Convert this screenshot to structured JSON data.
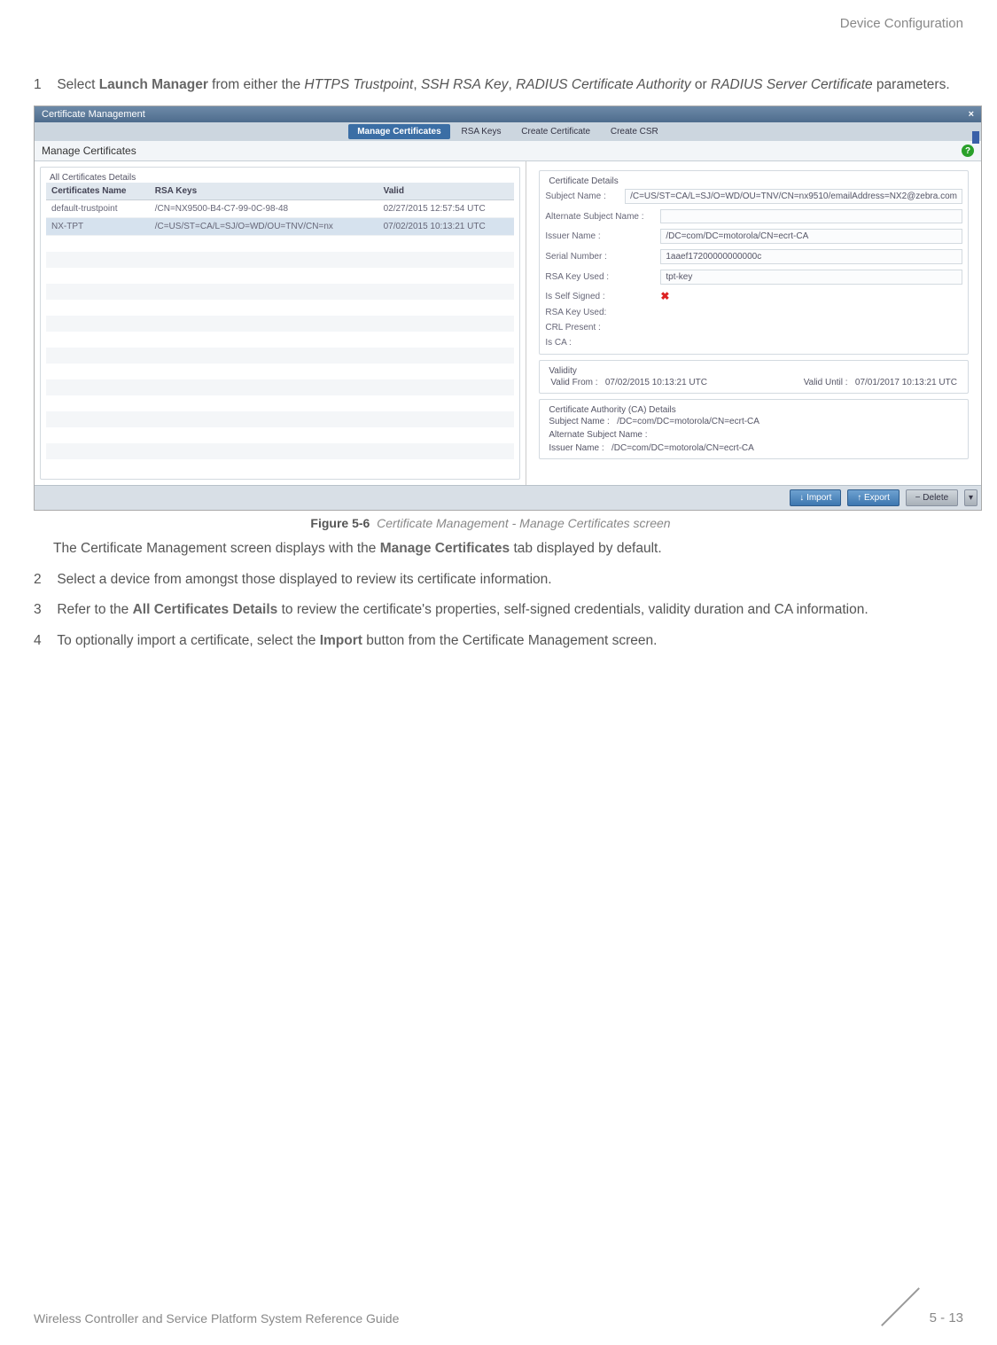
{
  "header": {
    "section_title": "Device Configuration"
  },
  "steps": {
    "s1": {
      "num": "1",
      "pre": "Select ",
      "launch": "Launch Manager",
      "mid1": " from either the ",
      "p1": "HTTPS Trustpoint",
      "c1": ", ",
      "p2": "SSH RSA Key",
      "c2": ", ",
      "p3": "RADIUS Certificate Authority",
      "or": " or ",
      "p4": "RADIUS Server Certificate",
      "end": " parameters."
    },
    "post1": {
      "pre": "The Certificate Management screen displays with the ",
      "tab": "Manage Certificates",
      "end": " tab displayed by default."
    },
    "s2": {
      "num": "2",
      "txt": "Select a device from amongst those displayed to review its certificate information."
    },
    "s3": {
      "num": "3",
      "pre": "Refer to the ",
      "bold": "All Certificates Details",
      "end": " to review the certificate's properties, self-signed credentials, validity duration and CA information."
    },
    "s4": {
      "num": "4",
      "pre": "To optionally import a certificate, select the ",
      "bold": "Import",
      "end": " button from the Certificate Management screen."
    }
  },
  "fig": {
    "label": "Figure 5-6",
    "caption": "Certificate Management - Manage Certificates screen"
  },
  "ss": {
    "title": "Certificate Management",
    "tabs": [
      "Manage Certificates",
      "RSA Keys",
      "Create Certificate",
      "Create CSR"
    ],
    "subtitle": "Manage Certificates",
    "left_fs": "All Certificates Details",
    "table_headers": [
      "Certificates Name",
      "RSA Keys",
      "Valid"
    ],
    "rows": [
      {
        "name": "default-trustpoint",
        "rsa": "/CN=NX9500-B4-C7-99-0C-98-48",
        "valid": "02/27/2015 12:57:54 UTC"
      },
      {
        "name": "NX-TPT",
        "rsa": "/C=US/ST=CA/L=SJ/O=WD/OU=TNV/CN=nx",
        "valid": "07/02/2015 10:13:21 UTC"
      }
    ],
    "right_fs": "Certificate Details",
    "details": {
      "subject_lbl": "Subject Name :",
      "subject_val": "/C=US/ST=CA/L=SJ/O=WD/OU=TNV/CN=nx9510/emailAddress=NX2@zebra.com",
      "alt_lbl": "Alternate Subject Name :",
      "alt_val": "",
      "issuer_lbl": "Issuer Name :",
      "issuer_val": "/DC=com/DC=motorola/CN=ecrt-CA",
      "serial_lbl": "Serial Number :",
      "serial_val": "1aaef17200000000000c",
      "rsakey_lbl": "RSA Key Used :",
      "rsakey_val": "tpt-key",
      "self_lbl": "Is Self Signed :",
      "rsaused_lbl": "RSA Key Used:",
      "crl_lbl": "CRL Present :",
      "isca_lbl": "Is CA :"
    },
    "validity": {
      "fs": "Validity",
      "from_lbl": "Valid From :",
      "from_val": "07/02/2015 10:13:21 UTC",
      "until_lbl": "Valid Until :",
      "until_val": "07/01/2017 10:13:21 UTC"
    },
    "ca": {
      "fs": "Certificate Authority (CA) Details",
      "subj_lbl": "Subject Name :",
      "subj_val": "/DC=com/DC=motorola/CN=ecrt-CA",
      "alt_lbl": "Alternate Subject Name :",
      "iss_lbl": "Issuer Name :",
      "iss_val": "/DC=com/DC=motorola/CN=ecrt-CA"
    },
    "buttons": {
      "import": "Import",
      "export": "Export",
      "delete": "Delete"
    }
  },
  "footer": {
    "left": "Wireless Controller and Service Platform System Reference Guide",
    "page": "5 - 13"
  }
}
